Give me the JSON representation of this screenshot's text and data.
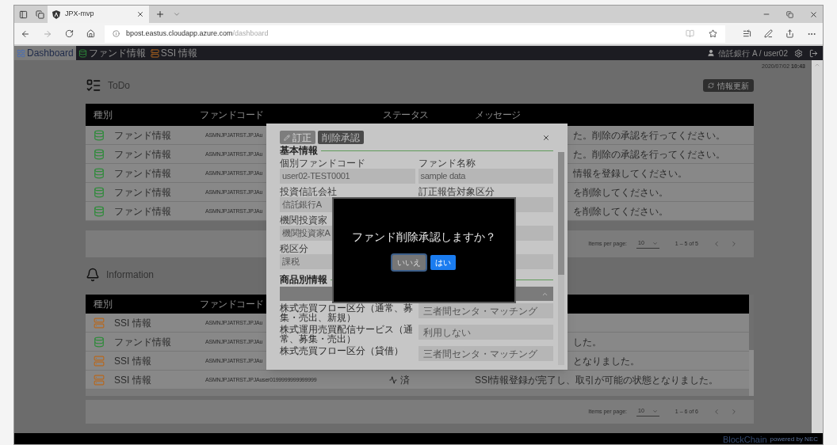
{
  "browser": {
    "tabs": [
      {
        "title": "JPX-mvp",
        "selected": true
      }
    ],
    "url_host": "bpost.eastus.cloudapp.azure.com",
    "url_path": "/dashboard"
  },
  "nav": {
    "items": [
      {
        "label": "Dashboard",
        "kind": "dashboard",
        "selected": true
      },
      {
        "label": "ファンド情報",
        "kind": "fund",
        "selected": false
      },
      {
        "label": "SSI 情報",
        "kind": "ssi",
        "selected": false
      }
    ],
    "user": "信託銀行 A / user02",
    "date": "2020/07/02",
    "time": "10:43"
  },
  "todo": {
    "title": "ToDo",
    "refresh_button": "情報更新",
    "columns": [
      "種別",
      "ファンドコード",
      "ステータス",
      "メッセージ"
    ],
    "rows": [
      {
        "kind": "fund",
        "type": "ファンド情報",
        "code": "ASMNJPJATRST.JPJAu",
        "message": "た。削除の承認を行ってください。",
        "partly_hidden": true
      },
      {
        "kind": "fund",
        "type": "ファンド情報",
        "code": "ASMNJPJATRST.JPJAu",
        "message": "た。削除の承認を行ってください。",
        "partly_hidden": true
      },
      {
        "kind": "fund",
        "type": "ファンド情報",
        "code": "ASMNJPJATRST.JPJAu",
        "message": "情報を登録してください。",
        "partly_hidden": true
      },
      {
        "kind": "fund",
        "type": "ファンド情報",
        "code": "ASMNJPJATRST.JPJAu",
        "message": "を削除してください。",
        "partly_hidden": true
      },
      {
        "kind": "fund",
        "type": "ファンド情報",
        "code": "ASMNJPJATRST.JPJAu",
        "message": "を削除してください。",
        "partly_hidden": true
      }
    ],
    "paginator": {
      "label": "Items per page:",
      "page_size": "10",
      "range": "1 – 5 of 5"
    }
  },
  "information": {
    "title": "Information",
    "columns": [
      "種別",
      "ファンドコード"
    ],
    "rows": [
      {
        "kind": "ssi",
        "type": "SSI 情報",
        "code": "ASMNJPJATRST.JPJAu"
      },
      {
        "kind": "fund",
        "type": "ファンド情報",
        "code": "ASMNJPJATRST.JPJAu",
        "message": "した。",
        "partly_hidden": true
      },
      {
        "kind": "ssi",
        "type": "SSI 情報",
        "code": "ASMNJPJATRST.JPJAu",
        "message": "となりました。",
        "partly_hidden": true
      },
      {
        "kind": "ssi",
        "type": "SSI 情報",
        "code": "ASMNJPJATRST.JPJAuser0199999999999999",
        "status": "済",
        "message": "SSI情報登録が完了し、取引が可能の状態となりました。",
        "partly_hidden": false
      }
    ],
    "paginator": {
      "label": "Items per page:",
      "page_size": "10",
      "range": "1 – 6 of 6"
    }
  },
  "modal": {
    "actions": [
      {
        "label": "訂正",
        "kind": "edit"
      },
      {
        "label": "削除承認",
        "kind": "plain"
      }
    ],
    "basic": {
      "title": "基本情報",
      "fields": [
        {
          "kind": "field",
          "label": "個別ファンドコード",
          "value": "user02-TEST0001"
        },
        {
          "kind": "field",
          "label": "ファンド名称",
          "value": "sample data"
        },
        {
          "kind": "field",
          "label": "投資信託会社",
          "value": "信託銀行A"
        },
        {
          "kind": "field",
          "label": "訂正報告対象区分"
        },
        {
          "kind": "field",
          "label": "機関投資家",
          "value": "機関投資家A"
        },
        {
          "kind": "field"
        },
        {
          "kind": "field",
          "label": "税区分",
          "value": "課税"
        },
        {
          "kind": "field"
        }
      ]
    },
    "product": {
      "title": "商品別情報",
      "group_expanded": true,
      "rows": [
        {
          "label": "株式売買フロー区分（通常、募集・売出、新規）",
          "value": "三者間センタ・マッチング"
        },
        {
          "label": "株式運用売買配信サービス（通常、募集・売出）",
          "value": "利用しない"
        },
        {
          "label": "株式売買フロー区分（貸借）",
          "value": "三者間センタ・マッチング"
        }
      ]
    }
  },
  "confirm": {
    "message": "ファンド削除承認しますか？",
    "buttons": [
      {
        "label": "いいえ",
        "kind": "secondary",
        "focused": true
      },
      {
        "label": "はい",
        "kind": "primary",
        "focused": false
      }
    ]
  },
  "footer": {
    "brand": "BlockChain",
    "credit": "powered by NEC"
  }
}
